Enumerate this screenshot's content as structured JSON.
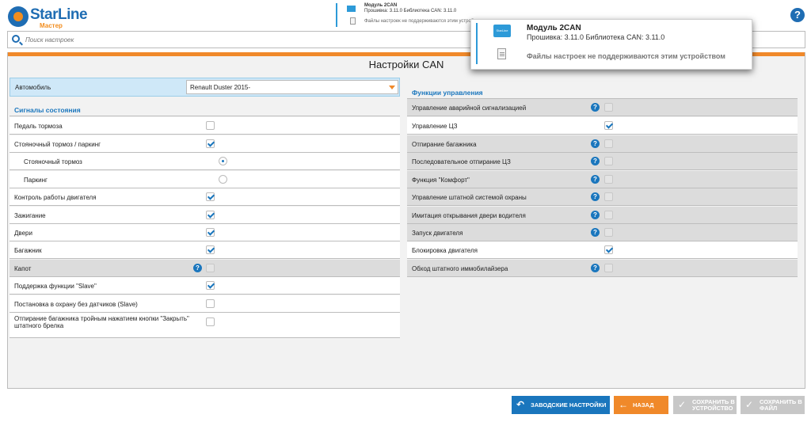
{
  "header": {
    "logo_brand": "StarLine",
    "logo_sub": "Мастер",
    "device": {
      "name": "Модуль 2CAN",
      "firmware": "Прошивка: 3.11.0   Библиотека CAN: 3.11.0",
      "message": "Файлы настроек не поддерживаются этим устройств"
    },
    "help": "?"
  },
  "search": {
    "placeholder": "Поиск настроек"
  },
  "page": {
    "title": "Настройки CAN",
    "car_label": "Автомобиль",
    "car_value": "Renault Duster 2015-"
  },
  "left": {
    "section_title": "Сигналы состояния",
    "items": [
      {
        "label": "Педаль тормоза",
        "state": "unchecked"
      },
      {
        "label": "Стояночный тормоз / паркинг",
        "state": "checked"
      },
      {
        "label": "Стояночный тормоз",
        "state": "radio_on"
      },
      {
        "label": "Паркинг",
        "state": "radio_off"
      },
      {
        "label": "Контроль работы двигателя",
        "state": "checked"
      },
      {
        "label": "Зажигание",
        "state": "checked"
      },
      {
        "label": "Двери",
        "state": "checked"
      },
      {
        "label": "Багажник",
        "state": "checked"
      },
      {
        "label": "Капот",
        "state": "disabled"
      },
      {
        "label": "Поддержка функции \"Slave\"",
        "state": "checked"
      },
      {
        "label": "Постановка в охрану без датчиков (Slave)",
        "state": "unchecked"
      },
      {
        "label": "Отпирание багажника тройным нажатием кнопки \"Закрыть\" штатного брелка",
        "state": "unchecked"
      }
    ]
  },
  "right": {
    "section_title": "Функции управления",
    "items": [
      {
        "label": "Управление аварийной сигнализацией",
        "state": "disabled"
      },
      {
        "label": "Управление ЦЗ",
        "state": "checked"
      },
      {
        "label": "Отпирание багажника",
        "state": "disabled"
      },
      {
        "label": "Последовательное отпирание ЦЗ",
        "state": "disabled"
      },
      {
        "label": "Функция \"Комфорт\"",
        "state": "disabled"
      },
      {
        "label": "Управление штатной системой охраны",
        "state": "disabled"
      },
      {
        "label": "Имитация открывания двери водителя",
        "state": "disabled"
      },
      {
        "label": "Запуск двигателя",
        "state": "disabled"
      },
      {
        "label": "Блокировка двигателя",
        "state": "checked"
      },
      {
        "label": "Обход штатного иммобилайзера",
        "state": "disabled"
      }
    ]
  },
  "popup": {
    "chip_text": "StarLine",
    "name": "Модуль 2CAN",
    "firmware": "Прошивка: 3.11.0   Библиотека CAN: 3.11.0",
    "message": "Файлы настроек не поддерживаются этим устройством"
  },
  "buttons": {
    "factory": "Заводские настройки",
    "back": "Назад",
    "save_device_1": "Сохранить в",
    "save_device_2": "устройство",
    "save_file_1": "Сохранить в",
    "save_file_2": "файл"
  },
  "colors": {
    "accent_blue": "#1a76bd",
    "accent_orange": "#f0892a",
    "disabled_row": "#dcdcdc"
  }
}
